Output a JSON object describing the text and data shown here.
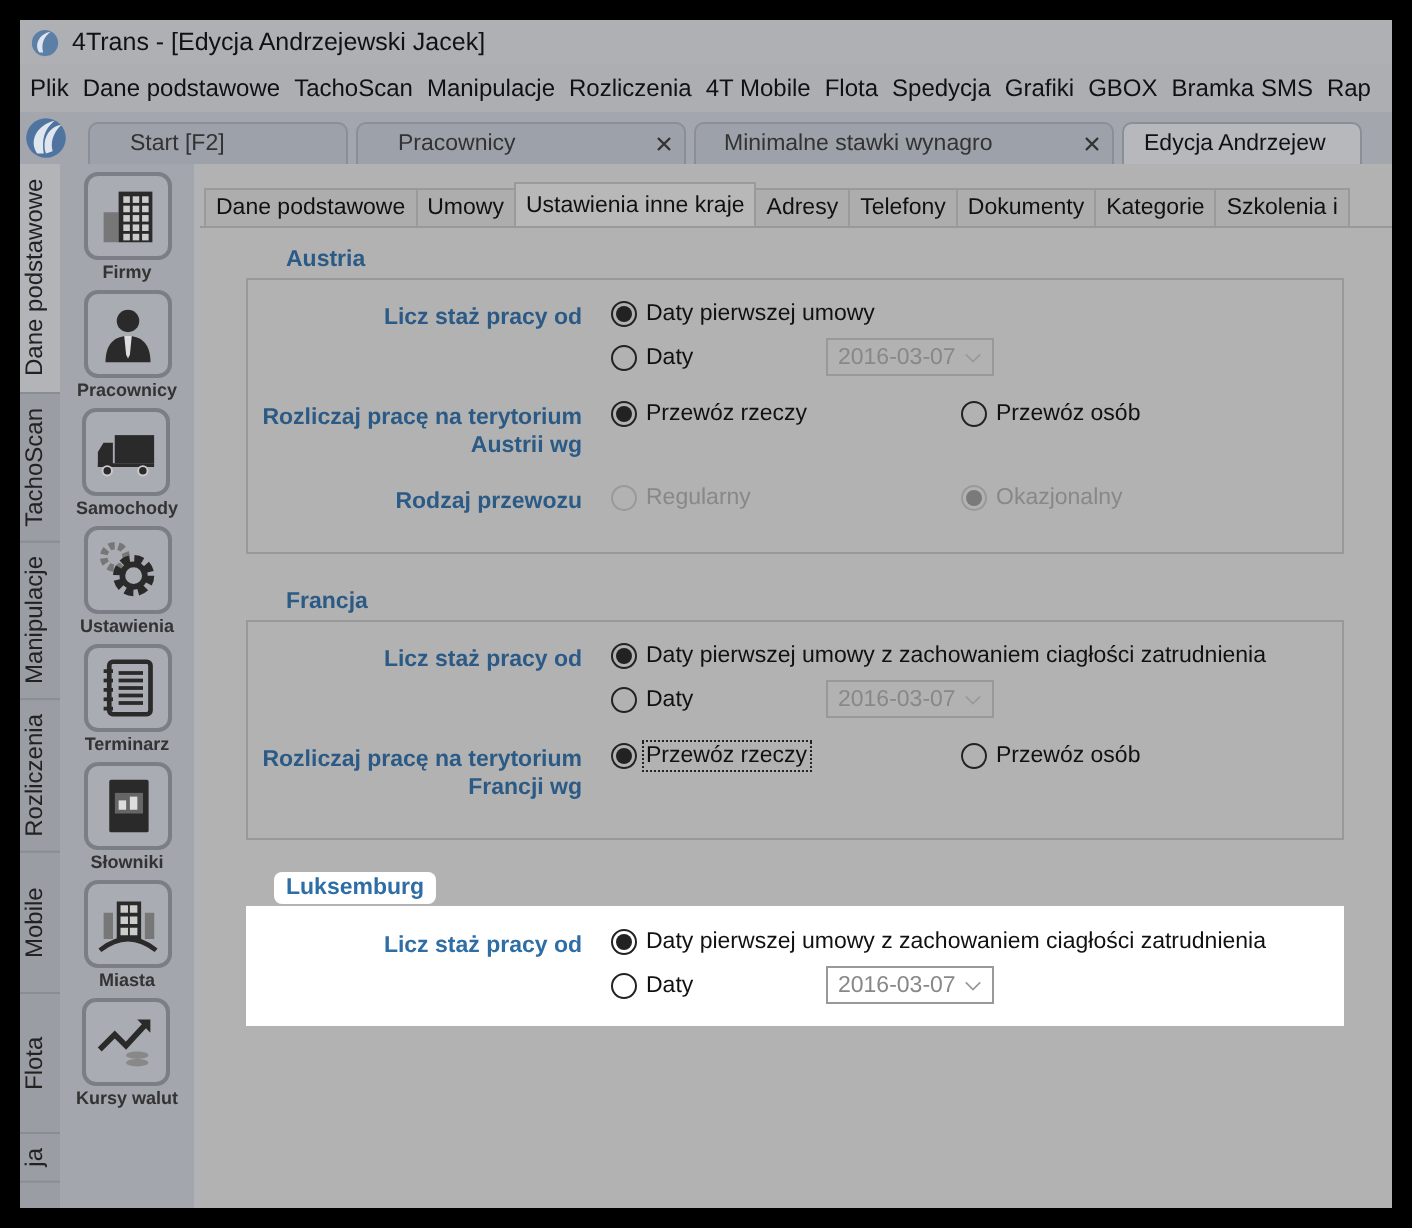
{
  "window": {
    "title": "4Trans - [Edycja Andrzejewski Jacek]"
  },
  "menu": [
    "Plik",
    "Dane podstawowe",
    "TachoScan",
    "Manipulacje",
    "Rozliczenia",
    "4T Mobile",
    "Flota",
    "Spedycja",
    "Grafiki",
    "GBOX",
    "Bramka SMS",
    "Rap"
  ],
  "doc_tabs": [
    {
      "label": "Start [F2]",
      "selected": false,
      "closable": false
    },
    {
      "label": "Pracownicy",
      "selected": false,
      "closable": true
    },
    {
      "label": "Minimalne stawki wynagro",
      "selected": false,
      "closable": true
    },
    {
      "label": "Edycja Andrzejew",
      "selected": true,
      "closable": false
    }
  ],
  "side_tabs": [
    {
      "label": "Dane podstawowe",
      "selected": true
    },
    {
      "label": "TachoScan",
      "selected": false
    },
    {
      "label": "Manipulacje",
      "selected": false
    },
    {
      "label": "Rozliczenia",
      "selected": false
    },
    {
      "label": "Mobile",
      "selected": false
    },
    {
      "label": "Flota",
      "selected": false
    },
    {
      "label": "ja",
      "selected": false
    }
  ],
  "launcher": [
    "Firmy",
    "Pracownicy",
    "Samochody",
    "Ustawienia",
    "Terminarz",
    "Słowniki",
    "Miasta",
    "Kursy walut"
  ],
  "content_tabs": [
    {
      "label": "Dane podstawowe",
      "selected": false
    },
    {
      "label": "Umowy",
      "selected": false
    },
    {
      "label": "Ustawienia inne kraje",
      "selected": true
    },
    {
      "label": "Adresy",
      "selected": false
    },
    {
      "label": "Telefony",
      "selected": false
    },
    {
      "label": "Dokumenty",
      "selected": false
    },
    {
      "label": "Kategorie",
      "selected": false
    },
    {
      "label": "Szkolenia i",
      "selected": false
    }
  ],
  "sections": [
    {
      "title": "Austria",
      "highlighted": false,
      "rows": [
        {
          "label": "Licz staż pracy od",
          "kind": "stacked",
          "options": [
            {
              "label": "Daty pierwszej umowy",
              "selected": true,
              "disabled": false,
              "focused": false
            },
            {
              "label": "Daty",
              "selected": false,
              "disabled": false,
              "focused": false,
              "date": "2016-03-07"
            }
          ]
        },
        {
          "label": "Rozliczaj pracę na terytorium Austrii wg",
          "kind": "inline",
          "options": [
            {
              "label": "Przewóz rzeczy",
              "selected": true,
              "disabled": false,
              "focused": false
            },
            {
              "label": "Przewóz osób",
              "selected": false,
              "disabled": false,
              "focused": false
            }
          ]
        },
        {
          "label": "Rodzaj przewozu",
          "kind": "inline",
          "options": [
            {
              "label": "Regularny",
              "selected": false,
              "disabled": true,
              "focused": false
            },
            {
              "label": "Okazjonalny",
              "selected": true,
              "disabled": true,
              "focused": false
            }
          ]
        }
      ]
    },
    {
      "title": "Francja",
      "highlighted": false,
      "rows": [
        {
          "label": "Licz staż pracy od",
          "kind": "stacked",
          "options": [
            {
              "label": "Daty pierwszej umowy z zachowaniem ciagłości zatrudnienia",
              "selected": true,
              "disabled": false,
              "focused": false
            },
            {
              "label": "Daty",
              "selected": false,
              "disabled": false,
              "focused": false,
              "date": "2016-03-07"
            }
          ]
        },
        {
          "label": "Rozliczaj pracę na terytorium Francji wg",
          "kind": "inline",
          "options": [
            {
              "label": "Przewóz rzeczy",
              "selected": true,
              "disabled": false,
              "focused": true
            },
            {
              "label": "Przewóz osób",
              "selected": false,
              "disabled": false,
              "focused": false
            }
          ]
        }
      ]
    },
    {
      "title": "Luksemburg",
      "highlighted": true,
      "rows": [
        {
          "label": "Licz staż pracy od",
          "kind": "stacked",
          "options": [
            {
              "label": "Daty pierwszej umowy z zachowaniem ciagłości zatrudnienia",
              "selected": true,
              "disabled": false,
              "focused": false
            },
            {
              "label": "Daty",
              "selected": false,
              "disabled": false,
              "focused": false,
              "date": "2016-03-07"
            }
          ]
        }
      ]
    }
  ]
}
